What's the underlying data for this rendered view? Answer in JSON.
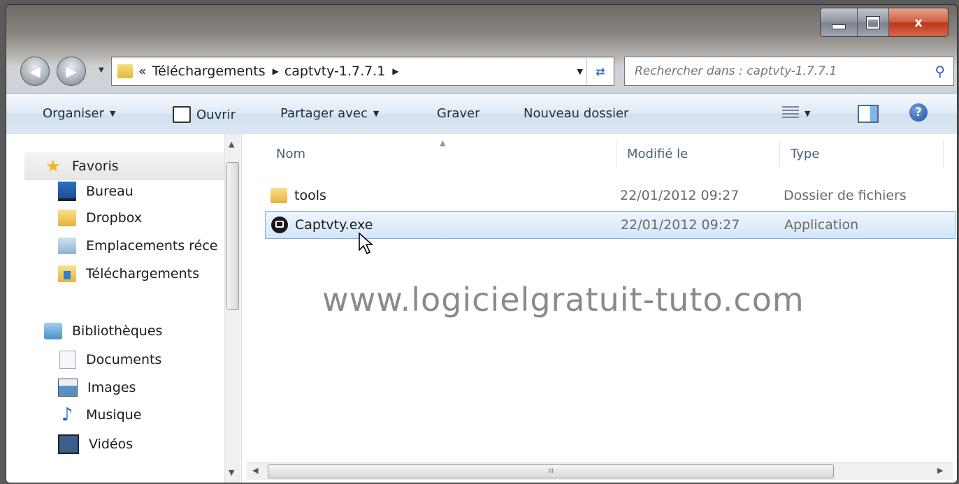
{
  "window": {
    "caption": {
      "minimize": "minimize",
      "maximize": "maximize",
      "close": "x"
    }
  },
  "nav": {
    "address": {
      "overflow": "«",
      "crumbs": [
        "Téléchargements",
        "captvty-1.7.7.1"
      ]
    },
    "search": {
      "placeholder": "Rechercher dans : captvty-1.7.7.1"
    }
  },
  "toolbar": {
    "organize": "Organiser",
    "open": "Ouvrir",
    "share": "Partager avec",
    "burn": "Graver",
    "new_folder": "Nouveau dossier"
  },
  "sidebar": {
    "favorites_label": "Favoris",
    "favorites": [
      {
        "label": "Bureau",
        "icon": "desktop-icon"
      },
      {
        "label": "Dropbox",
        "icon": "folder-icon"
      },
      {
        "label": "Emplacements récents",
        "icon": "recent-places-icon"
      },
      {
        "label": "Téléchargements",
        "icon": "downloads-icon"
      }
    ],
    "libraries_label": "Bibliothèques",
    "libraries": [
      {
        "label": "Documents",
        "icon": "documents-icon"
      },
      {
        "label": "Images",
        "icon": "pictures-icon"
      },
      {
        "label": "Musique",
        "icon": "music-icon"
      },
      {
        "label": "Vidéos",
        "icon": "videos-icon"
      }
    ]
  },
  "list": {
    "columns": {
      "name": "Nom",
      "modified": "Modifié le",
      "type": "Type"
    },
    "rows": [
      {
        "name": "tools",
        "modified": "22/01/2012 09:27",
        "type": "Dossier de fichiers",
        "icon": "folder-icon",
        "selected": false
      },
      {
        "name": "Captvty.exe",
        "modified": "22/01/2012 09:27",
        "type": "Application",
        "icon": "application-icon",
        "selected": true
      }
    ]
  },
  "watermark": "www.logicielgratuit-tuto.com",
  "scrollbar_grip": "III",
  "colors": {
    "selection": "#d3e6fa",
    "toolbar": "#dde7f3",
    "close_button": "#cf5a3c"
  }
}
